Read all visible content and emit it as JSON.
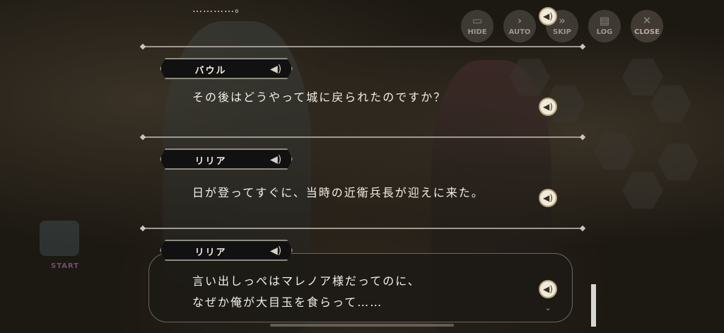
{
  "toolbar": {
    "hide_label": "HIDE",
    "auto_label": "AUTO",
    "skip_label": "SKIP",
    "log_label": "LOG",
    "close_label": "CLOSE"
  },
  "map": {
    "start_label": "START"
  },
  "log": {
    "first_line": "…………。",
    "entries": [
      {
        "speaker": "バウル",
        "lines": [
          "その後はどうやって城に戻られたのですか？"
        ]
      },
      {
        "speaker": "リリア",
        "lines": [
          "日が登ってすぐに、当時の近衛兵長が迎えに来た。"
        ]
      },
      {
        "speaker": "リリア",
        "lines": [
          "言い出しっぺはマレノア様だってのに、",
          "なぜか俺が大目玉を食らって……"
        ]
      }
    ]
  },
  "icons": {
    "speaker": "speaker-icon",
    "voice": "voice-replay-icon",
    "chevron": "chevron-down-icon"
  },
  "colors": {
    "background": "#1c1812",
    "text": "#f2efe7",
    "separator": "#9e9a92",
    "voice_button": "#f1eadb"
  }
}
